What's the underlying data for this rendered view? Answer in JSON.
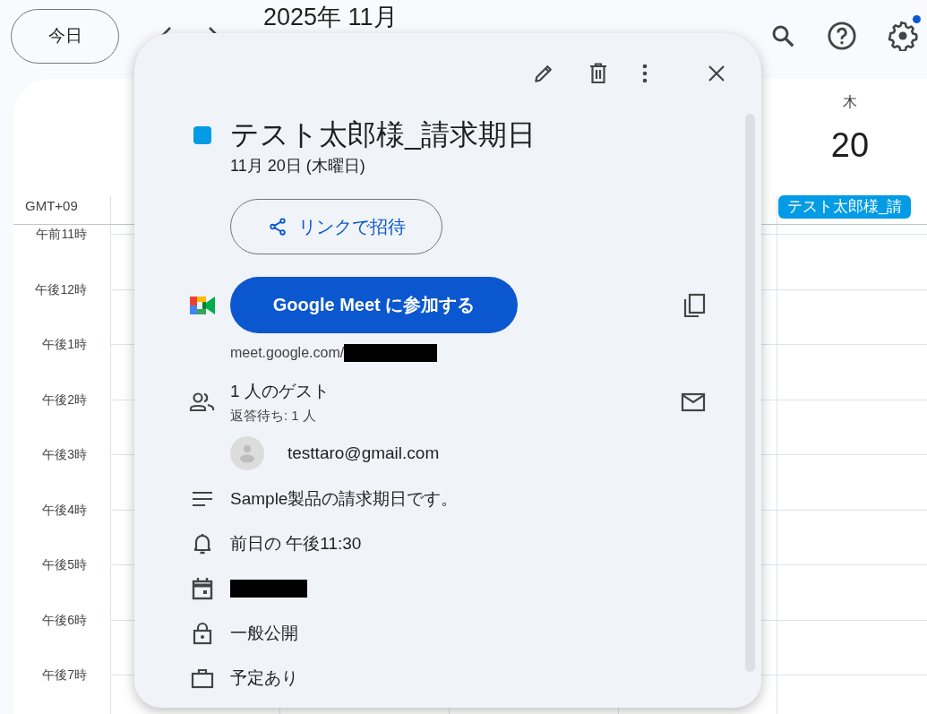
{
  "header": {
    "today_button": "今日",
    "title": "2025年 11月",
    "settings_notification": true
  },
  "calendar": {
    "timezone": "GMT+09",
    "day": {
      "weekday": "木",
      "date": "20"
    },
    "all_day_event": "テスト太郎様_請",
    "hours": [
      "午前11時",
      "午後12時",
      "午後1時",
      "午後2時",
      "午後3時",
      "午後4時",
      "午後5時",
      "午後6時",
      "午後7時"
    ]
  },
  "event_popup": {
    "title": "テスト太郎様_請求期日",
    "date": "11月 20日 (木曜日)",
    "invite_button": "リンクで招待",
    "meet_button": "Google Meet に参加する",
    "meet_link": "meet.google.com/",
    "guests": {
      "count": "1 人のゲスト",
      "pending": "返答待ち: 1 人",
      "list": [
        {
          "email": "testtaro@gmail.com"
        }
      ]
    },
    "description": "Sample製品の請求期日です。",
    "reminder": "前日の 午後11:30",
    "visibility": "一般公開",
    "availability": "予定あり"
  }
}
